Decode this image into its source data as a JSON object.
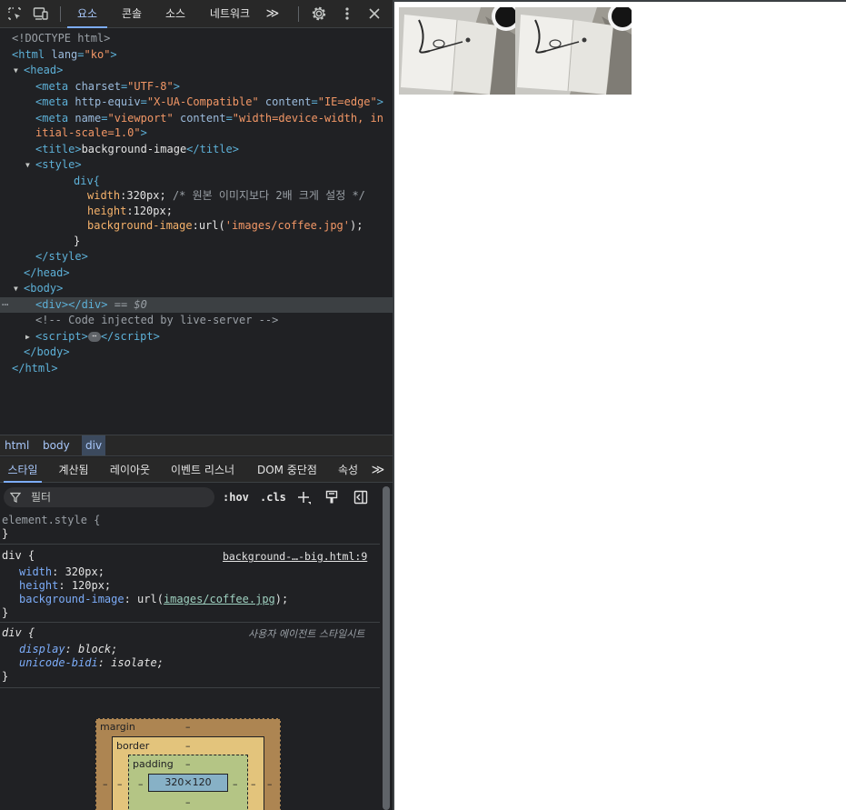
{
  "toolbar": {
    "tabs": [
      "요소",
      "콘솔",
      "소스",
      "네트워크"
    ],
    "more": "≫",
    "icons": [
      "inspect-icon",
      "device-toolbar-icon",
      "settings-icon",
      "kebab-menu-icon",
      "close-icon"
    ]
  },
  "tree": {
    "doctype": "<!DOCTYPE html>",
    "html_open_tag": "html",
    "html_attr": "lang",
    "html_attr_val": "\"ko\"",
    "head": "head",
    "meta1_attr": "charset",
    "meta1_val": "\"UTF-8\"",
    "meta2_attr1": "http-equiv",
    "meta2_val1": "\"X-UA-Compatible\"",
    "meta2_attr2": "content",
    "meta2_val2": "\"IE=edge\"",
    "meta3_attr1": "name",
    "meta3_val1": "\"viewport\"",
    "meta3_attr2": "content",
    "meta3_val2a": "\"width=device-width, in",
    "meta3_val2b": "itial-scale=1.0\"",
    "title_text": "background-image",
    "style": "style",
    "css_selector": "div{",
    "css_width_prop": "width",
    "css_width_val": "320px;",
    "css_width_comment": "/* 원본 이미지보다 2배 크게 설정 */",
    "css_height_prop": "height",
    "css_height_val": "120px;",
    "css_bg_prop": "background-image",
    "css_bg_val_pre": "url(",
    "css_bg_val_str": "'images/coffee.jpg'",
    "css_bg_val_post": ");",
    "css_close": "}",
    "body": "body",
    "selected_suffix": "== $0",
    "comment": "<!-- Code injected by live-server -->",
    "script": "script"
  },
  "breadcrumbs": [
    "html",
    "body",
    "div"
  ],
  "subtabs": [
    "스타일",
    "계산됨",
    "레이아웃",
    "이벤트 리스너",
    "DOM 중단점",
    "속성"
  ],
  "filter": {
    "placeholder": "필터",
    "hov": ":hov",
    "cls": ".cls"
  },
  "styles": {
    "element_style": "element.style {",
    "close": "}",
    "rule1_selector": "div {",
    "rule1_source": "background-…-big.html:9",
    "rule1_width_prop": "width",
    "rule1_width_val": "320px;",
    "rule1_height_prop": "height",
    "rule1_height_val": "120px;",
    "rule1_bg_prop": "background-image",
    "rule1_bg_pre": "url(",
    "rule1_bg_url": "images/coffee.jpg",
    "rule1_bg_post": ");",
    "rule2_selector": "div {",
    "rule2_source": "사용자 에이전트 스타일시트",
    "rule2_display_prop": "display",
    "rule2_display_val": "block;",
    "rule2_unicode_prop": "unicode-bidi",
    "rule2_unicode_val": "isolate;"
  },
  "box_model": {
    "margin_label": "margin",
    "border_label": "border",
    "padding_label": "padding",
    "content_size": "320×120",
    "dash": "–"
  },
  "colors": {
    "devtools_bg": "#202124",
    "accent": "#a8c7fa",
    "tag": "#5db0d7",
    "attr_value": "#f29766",
    "margin": "#ad8552",
    "border": "#e3c47c",
    "padding": "#b4c585",
    "content": "#87b1c6"
  }
}
